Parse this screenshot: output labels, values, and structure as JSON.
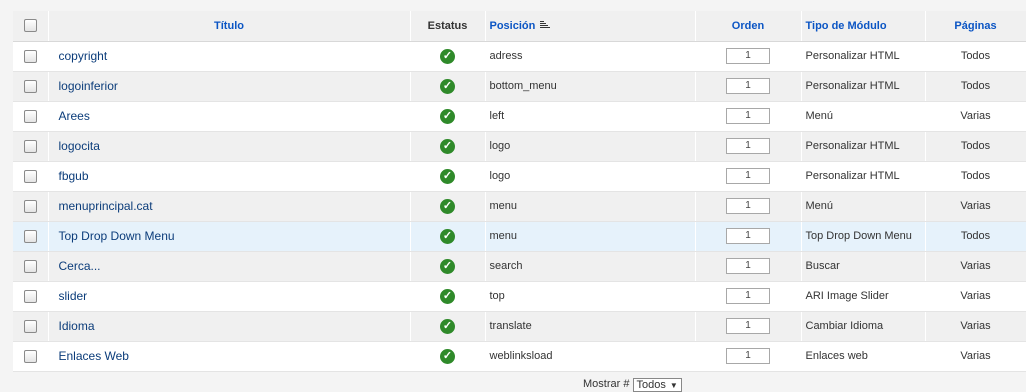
{
  "headers": {
    "titulo": "Título",
    "estatus": "Estatus",
    "posicion": "Posición",
    "orden": "Orden",
    "tipo": "Tipo de Módulo",
    "paginas": "Páginas"
  },
  "rows": [
    {
      "title": "copyright",
      "position": "adress",
      "order": "1",
      "type": "Personalizar HTML",
      "pages": "Todos"
    },
    {
      "title": "logoinferior",
      "position": "bottom_menu",
      "order": "1",
      "type": "Personalizar HTML",
      "pages": "Todos"
    },
    {
      "title": "Arees",
      "position": "left",
      "order": "1",
      "type": "Menú",
      "pages": "Varias"
    },
    {
      "title": "logocita",
      "position": "logo",
      "order": "1",
      "type": "Personalizar HTML",
      "pages": "Todos"
    },
    {
      "title": "fbgub",
      "position": "logo",
      "order": "1",
      "type": "Personalizar HTML",
      "pages": "Todos"
    },
    {
      "title": "menuprincipal.cat",
      "position": "menu",
      "order": "1",
      "type": "Menú",
      "pages": "Varias"
    },
    {
      "title": "Top Drop Down Menu",
      "position": "menu",
      "order": "1",
      "type": "Top Drop Down Menu",
      "pages": "Todos"
    },
    {
      "title": "Cerca...",
      "position": "search",
      "order": "1",
      "type": "Buscar",
      "pages": "Varias"
    },
    {
      "title": "slider",
      "position": "top",
      "order": "1",
      "type": "ARI Image Slider",
      "pages": "Varias"
    },
    {
      "title": "Idioma",
      "position": "translate",
      "order": "1",
      "type": "Cambiar Idioma",
      "pages": "Varias"
    },
    {
      "title": "Enlaces Web",
      "position": "weblinksload",
      "order": "1",
      "type": "Enlaces web",
      "pages": "Varias"
    }
  ],
  "footer": {
    "label": "Mostrar #",
    "value": "Todos"
  },
  "icons": {
    "status": "check-circle-icon",
    "sort": "sort-ascending-icon"
  },
  "colors": {
    "link": "#0b55c4",
    "status_ok": "#2f8a2a",
    "highlight_row": "#e6f2fb"
  }
}
